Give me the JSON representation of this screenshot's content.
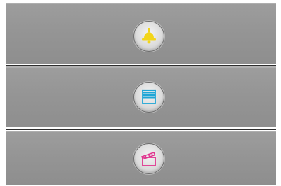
{
  "buttons": [
    {
      "id": "light",
      "icon": "ceiling-lamp-icon",
      "color": "#f2d51a"
    },
    {
      "id": "blinds",
      "icon": "window-blinds-icon",
      "color": "#1fa6d6"
    },
    {
      "id": "scene",
      "icon": "clapperboard-icon",
      "color": "#e0358f"
    }
  ],
  "colors": {
    "panel": "#969696",
    "divider": "#2e2e2e",
    "button_face": "#dcdcdc"
  }
}
